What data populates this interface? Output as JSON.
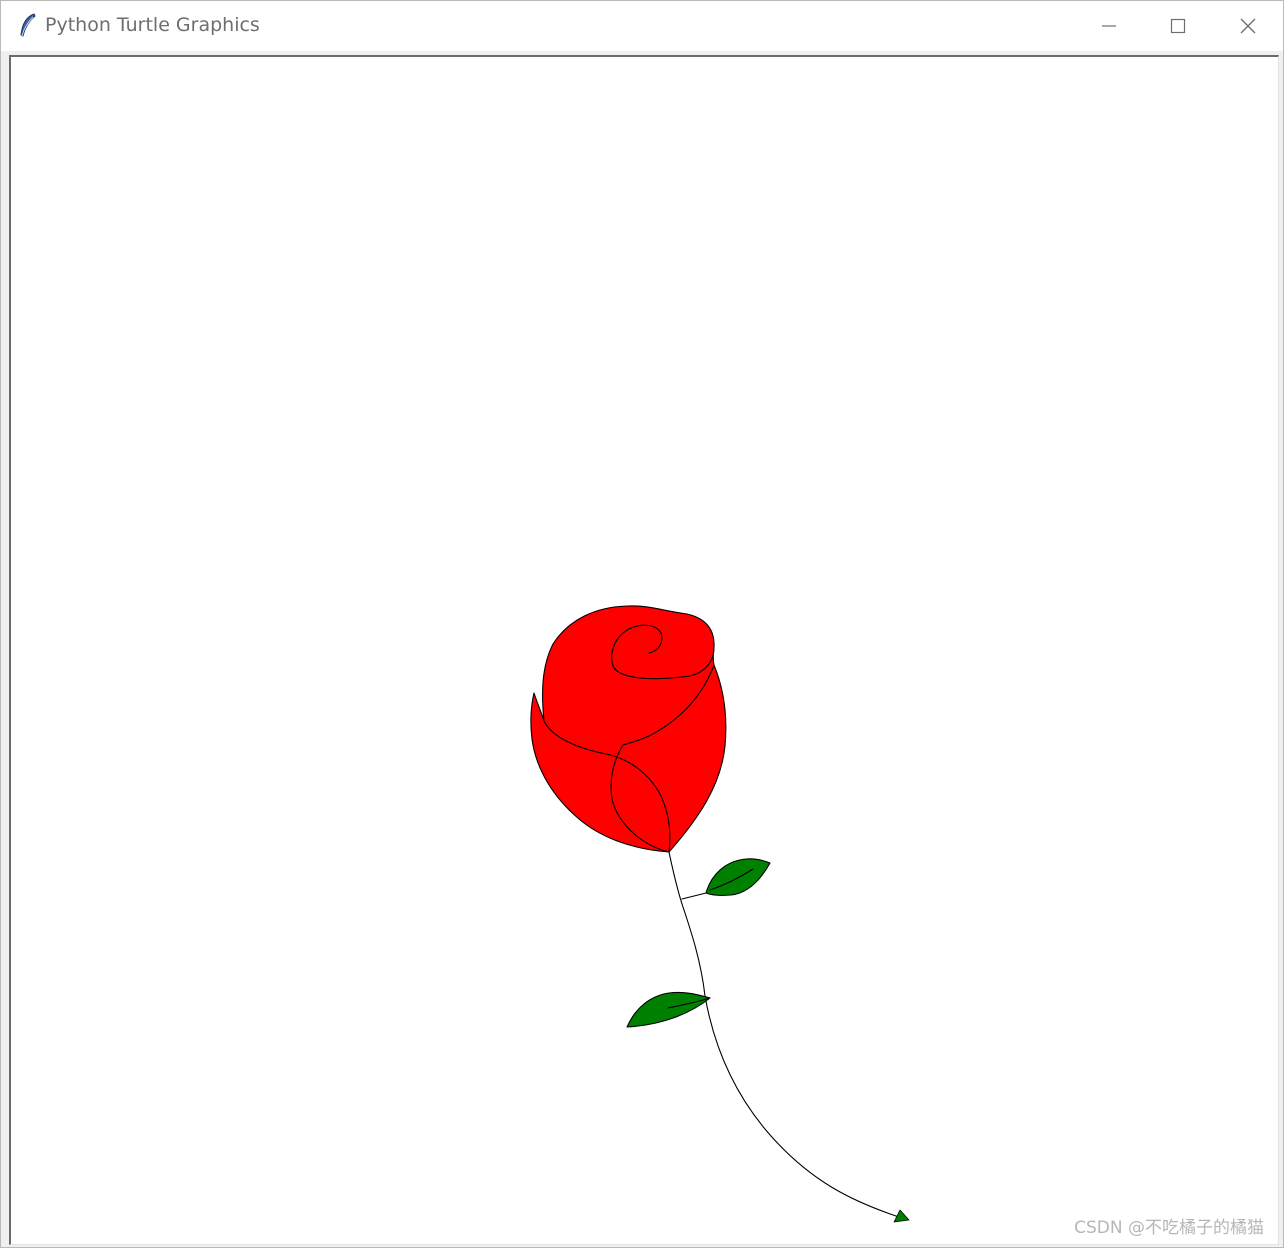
{
  "window": {
    "title": "Python Turtle Graphics",
    "icon": "feather-icon",
    "controls": {
      "minimize": "minimize-icon",
      "maximize": "maximize-icon",
      "close": "close-icon"
    }
  },
  "canvas": {
    "background": "#ffffff",
    "drawing": "rose",
    "colors": {
      "petal_fill": "#ff0000",
      "leaf_fill": "#008000",
      "outline": "#000000",
      "turtle": "#008000"
    },
    "turtle_shape": "arrow"
  },
  "watermark": "CSDN @不吃橘子的橘猫"
}
